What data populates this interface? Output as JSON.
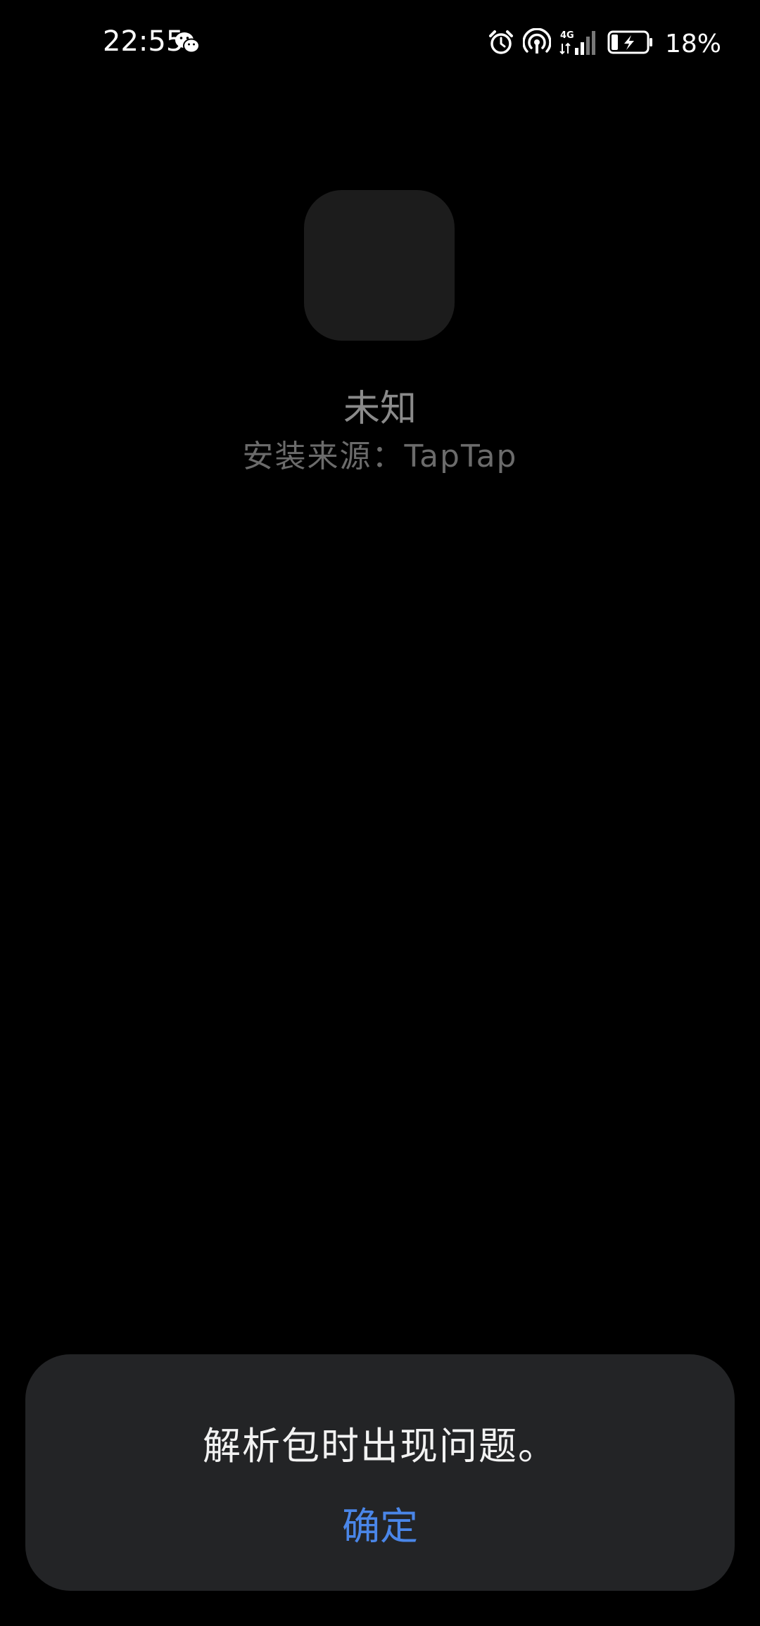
{
  "status_bar": {
    "time": "22:55",
    "battery_percent": "18%",
    "network": "4G",
    "icons": [
      "wechat-icon",
      "alarm-icon",
      "hotspot-icon",
      "signal-icon",
      "battery-charging-icon"
    ]
  },
  "app": {
    "name": "未知",
    "source": "安装来源：TapTap"
  },
  "dialog": {
    "message": "解析包时出现问题。",
    "confirm_label": "确定"
  },
  "colors": {
    "background": "#000000",
    "dialog_bg": "#232426",
    "accent": "#4a86e8"
  }
}
